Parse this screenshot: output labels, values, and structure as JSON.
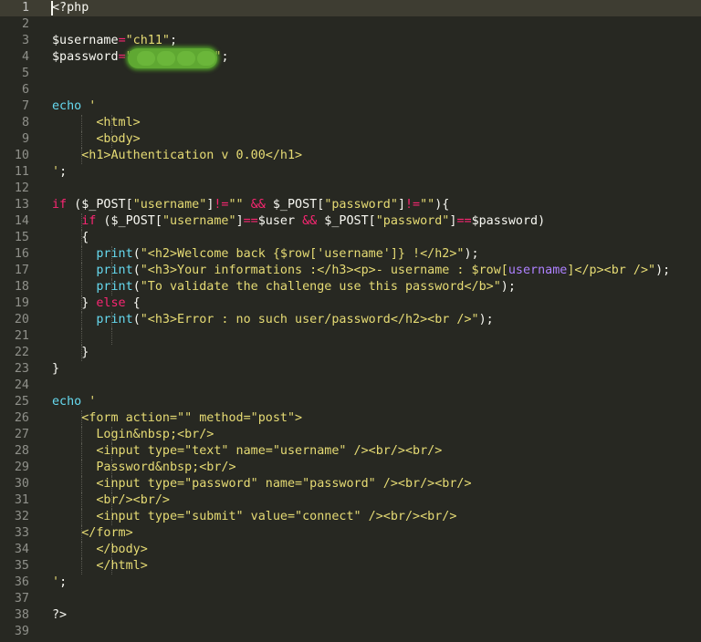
{
  "colors": {
    "background": "#272822",
    "active_line": "#3E3D32",
    "line_number": "#8F908A",
    "text": "#F8F8F2",
    "string": "#E6DB74",
    "keyword": "#F92672",
    "builtin": "#66D9EF",
    "constant": "#AE81FF",
    "redaction": "#5FA832"
  },
  "editor": {
    "active_line": 1,
    "lines": [
      {
        "n": "1",
        "indent": 0,
        "tokens": [
          {
            "t": "<?php",
            "c": "text"
          }
        ]
      },
      {
        "n": "2",
        "indent": 0,
        "tokens": []
      },
      {
        "n": "3",
        "indent": 0,
        "tokens": [
          {
            "t": "$username",
            "c": "text"
          },
          {
            "t": "=",
            "c": "keyword"
          },
          {
            "t": "\"ch11\"",
            "c": "string"
          },
          {
            "t": ";",
            "c": "text"
          }
        ]
      },
      {
        "n": "4",
        "indent": 0,
        "tokens": [
          {
            "t": "$password",
            "c": "text"
          },
          {
            "t": "=",
            "c": "keyword"
          },
          {
            "t": "\"",
            "c": "string"
          },
          {
            "t": "           ",
            "c": "redacted"
          },
          {
            "t": "\"",
            "c": "string"
          },
          {
            "t": ";",
            "c": "text"
          }
        ]
      },
      {
        "n": "5",
        "indent": 0,
        "tokens": []
      },
      {
        "n": "6",
        "indent": 0,
        "tokens": []
      },
      {
        "n": "7",
        "indent": 0,
        "tokens": [
          {
            "t": "echo",
            "c": "builtin"
          },
          {
            "t": " '",
            "c": "string"
          }
        ]
      },
      {
        "n": "8",
        "indent": 2,
        "tokens": [
          {
            "t": "      <html>",
            "c": "string"
          }
        ]
      },
      {
        "n": "9",
        "indent": 2,
        "tokens": [
          {
            "t": "      <body>",
            "c": "string"
          }
        ]
      },
      {
        "n": "10",
        "indent": 1,
        "tokens": [
          {
            "t": "    <h1>Authentication v 0.00</h1>",
            "c": "string"
          }
        ]
      },
      {
        "n": "11",
        "indent": 0,
        "tokens": [
          {
            "t": "'",
            "c": "string"
          },
          {
            "t": ";",
            "c": "text"
          }
        ]
      },
      {
        "n": "12",
        "indent": 0,
        "tokens": []
      },
      {
        "n": "13",
        "indent": 0,
        "tokens": [
          {
            "t": "if",
            "c": "keyword"
          },
          {
            "t": " ($_POST[",
            "c": "text"
          },
          {
            "t": "\"username\"",
            "c": "string"
          },
          {
            "t": "]",
            "c": "text"
          },
          {
            "t": "!=",
            "c": "keyword"
          },
          {
            "t": "\"\"",
            "c": "string"
          },
          {
            "t": " ",
            "c": "text"
          },
          {
            "t": "&&",
            "c": "keyword"
          },
          {
            "t": " $_POST[",
            "c": "text"
          },
          {
            "t": "\"password\"",
            "c": "string"
          },
          {
            "t": "]",
            "c": "text"
          },
          {
            "t": "!=",
            "c": "keyword"
          },
          {
            "t": "\"\"",
            "c": "string"
          },
          {
            "t": "){",
            "c": "text"
          }
        ]
      },
      {
        "n": "14",
        "indent": 1,
        "tokens": [
          {
            "t": "    ",
            "c": "text"
          },
          {
            "t": "if",
            "c": "keyword"
          },
          {
            "t": " ($_POST[",
            "c": "text"
          },
          {
            "t": "\"username\"",
            "c": "string"
          },
          {
            "t": "]",
            "c": "text"
          },
          {
            "t": "==",
            "c": "keyword"
          },
          {
            "t": "$user ",
            "c": "text"
          },
          {
            "t": "&&",
            "c": "keyword"
          },
          {
            "t": " $_POST[",
            "c": "text"
          },
          {
            "t": "\"password\"",
            "c": "string"
          },
          {
            "t": "]",
            "c": "text"
          },
          {
            "t": "==",
            "c": "keyword"
          },
          {
            "t": "$password)",
            "c": "text"
          }
        ]
      },
      {
        "n": "15",
        "indent": 1,
        "tokens": [
          {
            "t": "    {",
            "c": "text"
          }
        ]
      },
      {
        "n": "16",
        "indent": 2,
        "tokens": [
          {
            "t": "      ",
            "c": "text"
          },
          {
            "t": "print",
            "c": "builtin"
          },
          {
            "t": "(",
            "c": "text"
          },
          {
            "t": "\"<h2>Welcome back {$row['username']} !</h2>\"",
            "c": "string"
          },
          {
            "t": ");",
            "c": "text"
          }
        ]
      },
      {
        "n": "17",
        "indent": 2,
        "tokens": [
          {
            "t": "      ",
            "c": "text"
          },
          {
            "t": "print",
            "c": "builtin"
          },
          {
            "t": "(",
            "c": "text"
          },
          {
            "t": "\"<h3>Your informations :</h3><p>- username : $row[",
            "c": "string"
          },
          {
            "t": "username",
            "c": "constant"
          },
          {
            "t": "]</p><br />\"",
            "c": "string"
          },
          {
            "t": ");",
            "c": "text"
          }
        ]
      },
      {
        "n": "18",
        "indent": 2,
        "tokens": [
          {
            "t": "      ",
            "c": "text"
          },
          {
            "t": "print",
            "c": "builtin"
          },
          {
            "t": "(",
            "c": "text"
          },
          {
            "t": "\"To validate the challenge use this password</b>\"",
            "c": "string"
          },
          {
            "t": ");",
            "c": "text"
          }
        ]
      },
      {
        "n": "19",
        "indent": 1,
        "tokens": [
          {
            "t": "    } ",
            "c": "text"
          },
          {
            "t": "else",
            "c": "keyword"
          },
          {
            "t": " {",
            "c": "text"
          }
        ]
      },
      {
        "n": "20",
        "indent": 2,
        "tokens": [
          {
            "t": "      ",
            "c": "text"
          },
          {
            "t": "print",
            "c": "builtin"
          },
          {
            "t": "(",
            "c": "text"
          },
          {
            "t": "\"<h3>Error : no such user/password</h2><br />\"",
            "c": "string"
          },
          {
            "t": ");",
            "c": "text"
          }
        ]
      },
      {
        "n": "21",
        "indent": 2,
        "tokens": []
      },
      {
        "n": "22",
        "indent": 1,
        "tokens": [
          {
            "t": "    }",
            "c": "text"
          }
        ]
      },
      {
        "n": "23",
        "indent": 0,
        "tokens": [
          {
            "t": "}",
            "c": "text"
          }
        ]
      },
      {
        "n": "24",
        "indent": 0,
        "tokens": []
      },
      {
        "n": "25",
        "indent": 0,
        "tokens": [
          {
            "t": "echo",
            "c": "builtin"
          },
          {
            "t": " '",
            "c": "string"
          }
        ]
      },
      {
        "n": "26",
        "indent": 1,
        "tokens": [
          {
            "t": "    <form action=\"\" method=\"post\">",
            "c": "string"
          }
        ]
      },
      {
        "n": "27",
        "indent": 2,
        "tokens": [
          {
            "t": "      Login&nbsp;<br/>",
            "c": "string"
          }
        ]
      },
      {
        "n": "28",
        "indent": 2,
        "tokens": [
          {
            "t": "      <input type=\"text\" name=\"username\" /><br/><br/>",
            "c": "string"
          }
        ]
      },
      {
        "n": "29",
        "indent": 2,
        "tokens": [
          {
            "t": "      Password&nbsp;<br/>",
            "c": "string"
          }
        ]
      },
      {
        "n": "30",
        "indent": 2,
        "tokens": [
          {
            "t": "      <input type=\"password\" name=\"password\" /><br/><br/>",
            "c": "string"
          }
        ]
      },
      {
        "n": "31",
        "indent": 2,
        "tokens": [
          {
            "t": "      <br/><br/>",
            "c": "string"
          }
        ]
      },
      {
        "n": "32",
        "indent": 2,
        "tokens": [
          {
            "t": "      <input type=\"submit\" value=\"connect\" /><br/><br/>",
            "c": "string"
          }
        ]
      },
      {
        "n": "33",
        "indent": 1,
        "tokens": [
          {
            "t": "    </form>",
            "c": "string"
          }
        ]
      },
      {
        "n": "34",
        "indent": 2,
        "tokens": [
          {
            "t": "      </body>",
            "c": "string"
          }
        ]
      },
      {
        "n": "35",
        "indent": 2,
        "tokens": [
          {
            "t": "      </html>",
            "c": "string"
          }
        ]
      },
      {
        "n": "36",
        "indent": 0,
        "tokens": [
          {
            "t": "'",
            "c": "string"
          },
          {
            "t": ";",
            "c": "text"
          }
        ]
      },
      {
        "n": "37",
        "indent": 0,
        "tokens": []
      },
      {
        "n": "38",
        "indent": 0,
        "tokens": [
          {
            "t": "?>",
            "c": "text"
          }
        ]
      },
      {
        "n": "39",
        "indent": 0,
        "tokens": []
      }
    ]
  }
}
